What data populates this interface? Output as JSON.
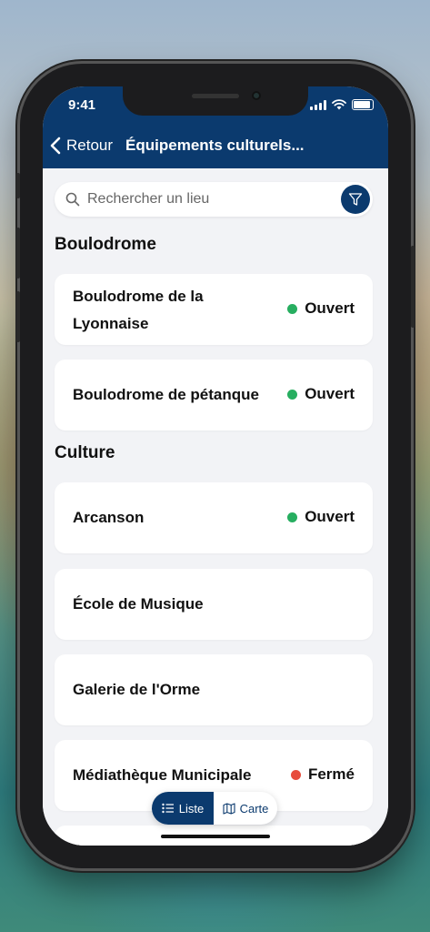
{
  "status_bar": {
    "time": "9:41"
  },
  "header": {
    "back_label": "Retour",
    "title": "Équipements culturels..."
  },
  "search": {
    "placeholder": "Rechercher un lieu"
  },
  "sections": [
    {
      "title": "Boulodrome",
      "items": [
        {
          "name": "Boulodrome de la Lyonnaise",
          "status": "Ouvert",
          "status_color": "#27ae60"
        },
        {
          "name": "Boulodrome de pétanque",
          "status": "Ouvert",
          "status_color": "#27ae60"
        }
      ]
    },
    {
      "title": "Culture",
      "items": [
        {
          "name": "Arcanson",
          "status": "Ouvert",
          "status_color": "#27ae60"
        },
        {
          "name": "École de Musique",
          "status": ""
        },
        {
          "name": "Galerie de l'Orme",
          "status": ""
        },
        {
          "name": "Médiathèque Municipale",
          "status": "Fermé",
          "status_color": "#e74c3c"
        }
      ]
    }
  ],
  "view_toggle": {
    "list_label": "Liste",
    "map_label": "Carte",
    "active": "Liste"
  },
  "colors": {
    "brand": "#0b3a6e",
    "open": "#27ae60",
    "closed": "#e74c3c"
  }
}
